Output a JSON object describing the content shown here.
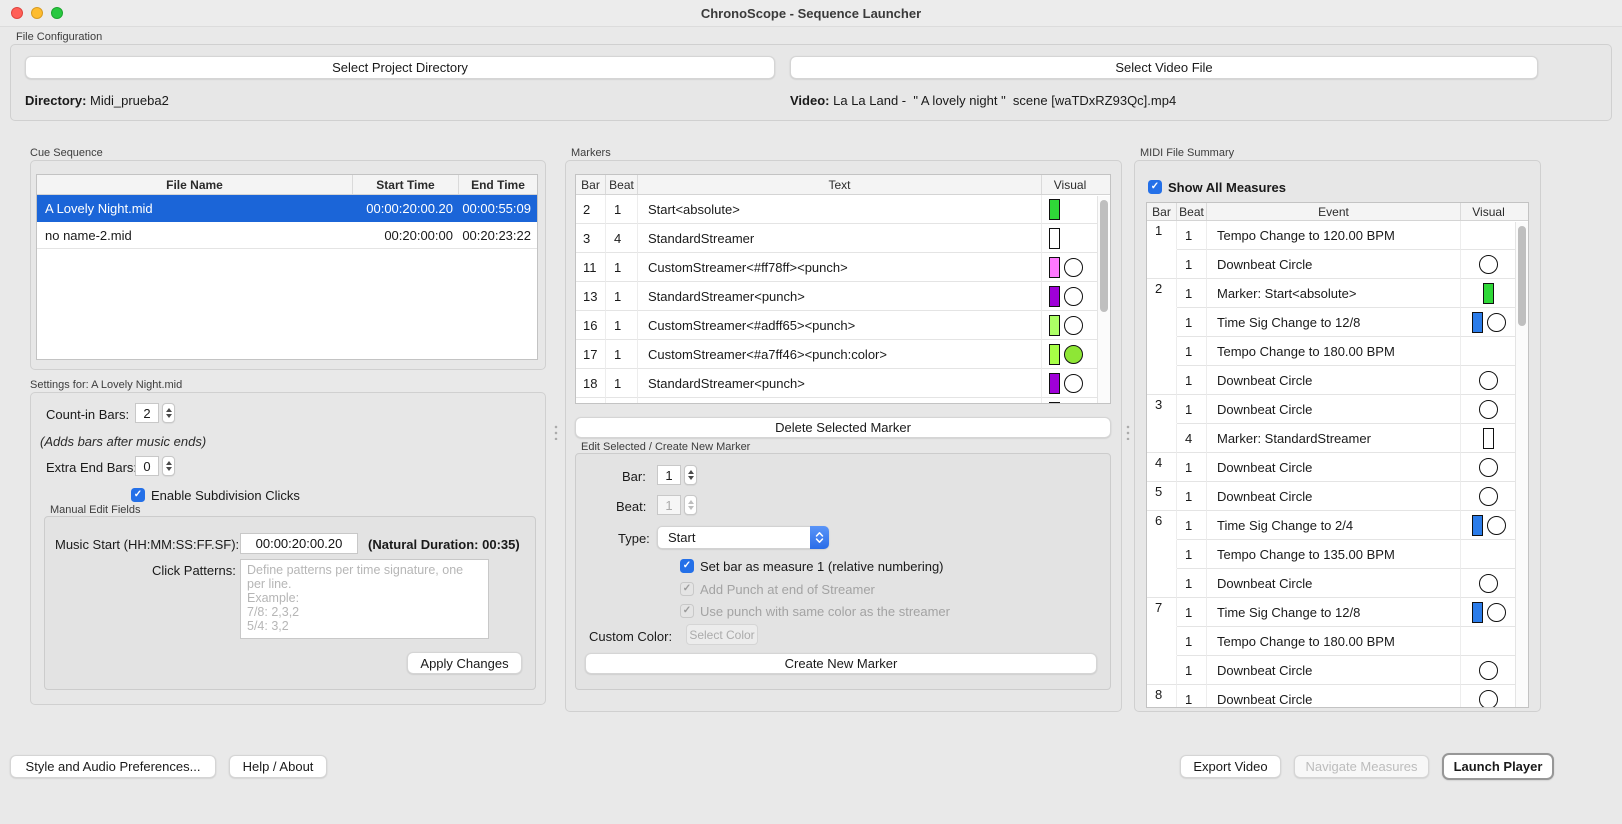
{
  "window": {
    "title": "ChronoScope - Sequence Launcher"
  },
  "file_config": {
    "group_label": "File Configuration",
    "select_project_button": "Select Project Directory",
    "select_video_button": "Select Video File",
    "directory_label": "Directory:",
    "directory_value": "Midi_prueba2",
    "video_label": "Video:",
    "video_value": "La La Land -  \" A lovely night \"  scene [waTDxRZ93Qc].mp4"
  },
  "cue_sequence": {
    "group_label": "Cue Sequence",
    "columns": [
      "File Name",
      "Start Time",
      "End Time"
    ],
    "rows": [
      {
        "file": "A Lovely Night.mid",
        "start": "00:00:20:00.20",
        "end": "00:00:55:09",
        "selected": true
      },
      {
        "file": "no name-2.mid",
        "start": "00:20:00:00",
        "end": "00:20:23:22",
        "selected": false
      }
    ]
  },
  "settings": {
    "group_label": "Settings for: A Lovely Night.mid",
    "count_in_label": "Count-in Bars:",
    "count_in_value": "2",
    "note": "(Adds bars after music ends)",
    "extra_end_label": "Extra End Bars:",
    "extra_end_value": "0",
    "subdivision_checkbox": "Enable Subdivision Clicks",
    "manual_edit": {
      "group_label": "Manual Edit Fields",
      "music_start_label": "Music Start (HH:MM:SS:FF.SF):",
      "music_start_value": "00:00:20:00.20",
      "natural_duration": "(Natural Duration: 00:35)",
      "click_patterns_label": "Click Patterns:",
      "click_patterns_placeholder": "Define patterns per time signature, one per line.\nExample:\n7/8: 2,3,2\n5/4: 3,2",
      "apply_button": "Apply Changes"
    }
  },
  "markers": {
    "group_label": "Markers",
    "columns": [
      "Bar",
      "Beat",
      "Text",
      "Visual"
    ],
    "rows": [
      {
        "bar": "2",
        "beat": "1",
        "text": "Start<absolute>",
        "visual": {
          "rect": "#2fd838"
        }
      },
      {
        "bar": "3",
        "beat": "4",
        "text": "StandardStreamer",
        "visual": {
          "rect": "#ffffff"
        }
      },
      {
        "bar": "11",
        "beat": "1",
        "text": "CustomStreamer<#ff78ff><punch>",
        "visual": {
          "rect": "#ff78ff",
          "circle": "#ffffff"
        }
      },
      {
        "bar": "13",
        "beat": "1",
        "text": "StandardStreamer<punch>",
        "visual": {
          "rect": "#9f00d8",
          "circle": "#ffffff"
        }
      },
      {
        "bar": "16",
        "beat": "1",
        "text": "CustomStreamer<#adff65><punch>",
        "visual": {
          "rect": "#adff65",
          "circle": "#ffffff"
        }
      },
      {
        "bar": "17",
        "beat": "1",
        "text": "CustomStreamer<#a7ff46><punch:color>",
        "visual": {
          "rect": "#a7ff46",
          "circle": "#8ee636"
        }
      },
      {
        "bar": "18",
        "beat": "1",
        "text": "StandardStreamer<punch>",
        "visual": {
          "rect": "#9f00d8",
          "circle": "#ffffff"
        }
      },
      {
        "bar": "",
        "beat": "",
        "text": "",
        "visual": {
          "rect": "#9f00d8",
          "circle": "#ffffff"
        }
      }
    ],
    "delete_button": "Delete Selected Marker",
    "edit_group": {
      "group_label": "Edit Selected / Create New Marker",
      "bar_label": "Bar:",
      "bar_value": "1",
      "beat_label": "Beat:",
      "beat_value": "1",
      "type_label": "Type:",
      "type_value": "Start",
      "set_bar_checkbox": "Set bar as measure 1 (relative numbering)",
      "add_punch_checkbox": "Add Punch at end of Streamer",
      "use_punch_checkbox": "Use punch with same color as the streamer",
      "custom_color_label": "Custom Color:",
      "select_color_button": "Select Color",
      "create_button": "Create New Marker"
    }
  },
  "midi_summary": {
    "group_label": "MIDI File Summary",
    "show_all_checkbox": "Show All Measures",
    "columns": [
      "Bar",
      "Beat",
      "Event",
      "Visual"
    ],
    "rows": [
      {
        "bar": "1",
        "beat": "1",
        "event": "Tempo Change to 120.00 BPM",
        "visual": {}
      },
      {
        "bar": "",
        "beat": "1",
        "event": "Downbeat Circle",
        "visual": {
          "circle": "#ffffff"
        }
      },
      {
        "bar": "2",
        "beat": "1",
        "event": "Marker: Start<absolute>",
        "visual": {
          "rect": "#2fd838"
        }
      },
      {
        "bar": "",
        "beat": "1",
        "event": "Time Sig Change to 12/8",
        "visual": {
          "rect": "#2b7ce9",
          "circle": "#ffffff"
        }
      },
      {
        "bar": "",
        "beat": "1",
        "event": "Tempo Change to 180.00 BPM",
        "visual": {}
      },
      {
        "bar": "",
        "beat": "1",
        "event": "Downbeat Circle",
        "visual": {
          "circle": "#ffffff"
        }
      },
      {
        "bar": "3",
        "beat": "1",
        "event": "Downbeat Circle",
        "visual": {
          "circle": "#ffffff"
        }
      },
      {
        "bar": "",
        "beat": "4",
        "event": "Marker: StandardStreamer",
        "visual": {
          "rect": "#ffffff"
        }
      },
      {
        "bar": "4",
        "beat": "1",
        "event": "Downbeat Circle",
        "visual": {
          "circle": "#ffffff"
        }
      },
      {
        "bar": "5",
        "beat": "1",
        "event": "Downbeat Circle",
        "visual": {
          "circle": "#ffffff"
        }
      },
      {
        "bar": "6",
        "beat": "1",
        "event": "Time Sig Change to 2/4",
        "visual": {
          "rect": "#2b7ce9",
          "circle": "#ffffff"
        }
      },
      {
        "bar": "",
        "beat": "1",
        "event": "Tempo Change to 135.00 BPM",
        "visual": {}
      },
      {
        "bar": "",
        "beat": "1",
        "event": "Downbeat Circle",
        "visual": {
          "circle": "#ffffff"
        }
      },
      {
        "bar": "7",
        "beat": "1",
        "event": "Time Sig Change to 12/8",
        "visual": {
          "rect": "#2b7ce9",
          "circle": "#ffffff"
        }
      },
      {
        "bar": "",
        "beat": "1",
        "event": "Tempo Change to 180.00 BPM",
        "visual": {}
      },
      {
        "bar": "",
        "beat": "1",
        "event": "Downbeat Circle",
        "visual": {
          "circle": "#ffffff"
        }
      },
      {
        "bar": "8",
        "beat": "1",
        "event": "Downbeat Circle",
        "visual": {
          "circle": "#ffffff"
        }
      }
    ]
  },
  "footer": {
    "style_prefs_button": "Style and Audio Preferences...",
    "help_button": "Help / About",
    "export_button": "Export Video",
    "navigate_button": "Navigate Measures",
    "launch_button": "Launch Player"
  },
  "colors": {
    "selection_blue": "#1b65d8",
    "checkbox_blue": "#2470e8",
    "timesig_blue": "#2b7ce9",
    "marker_green": "#2fd838",
    "streamer_purple": "#9f00d8"
  }
}
